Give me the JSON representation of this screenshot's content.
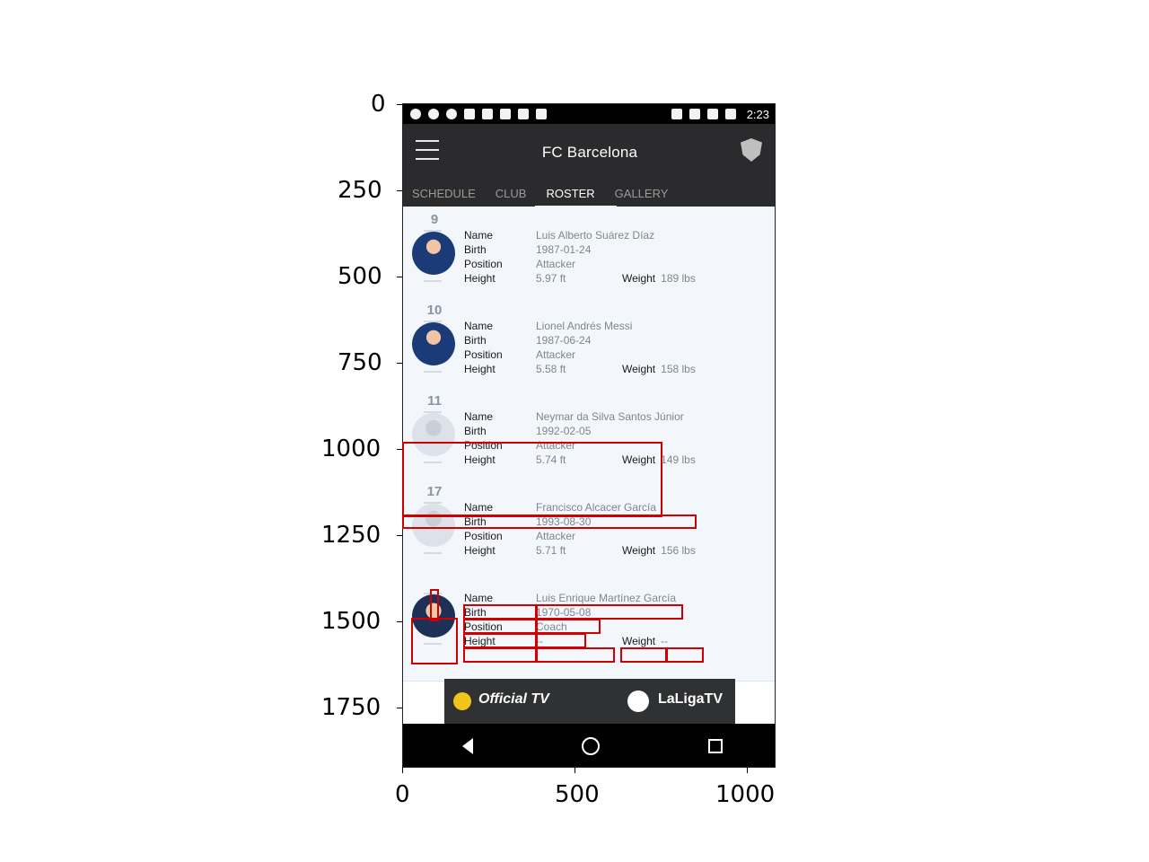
{
  "axes": {
    "y_ticks": [
      "0",
      "250",
      "500",
      "750",
      "1000",
      "1250",
      "1500",
      "1750"
    ],
    "x_ticks": [
      "0",
      "500",
      "1000"
    ]
  },
  "status_bar": {
    "time": "2:23"
  },
  "app": {
    "title": "FC Barcelona",
    "tabs": [
      "SCHEDULE",
      "CLUB",
      "ROSTER",
      "GALLERY"
    ],
    "active_tab": "ROSTER"
  },
  "labels": {
    "name": "Name",
    "birth": "Birth",
    "position": "Position",
    "height": "Height",
    "weight": "Weight"
  },
  "roster": [
    {
      "number": "9",
      "name": "Luis Alberto Suárez Díaz",
      "birth": "1987-01-24",
      "position": "Attacker",
      "height": "5.97 ft",
      "weight": "189 lbs",
      "avatar": "player-photo"
    },
    {
      "number": "10",
      "name": "Lionel Andrés Messi",
      "birth": "1987-06-24",
      "position": "Attacker",
      "height": "5.58 ft",
      "weight": "158 lbs",
      "avatar": "player-photo"
    },
    {
      "number": "11",
      "name": "Neymar da Silva Santos Júnior",
      "birth": "1992-02-05",
      "position": "Attacker",
      "height": "5.74 ft",
      "weight": "149 lbs",
      "avatar": "placeholder-silhouette"
    },
    {
      "number": "17",
      "name": "Francisco Alcacer García",
      "birth": "1993-08-30",
      "position": "Attacker",
      "height": "5.71 ft",
      "weight": "156 lbs",
      "avatar": "placeholder-silhouette"
    },
    {
      "number": "",
      "name": "Luis Enrique Martínez García",
      "birth": "1970-05-08",
      "position": "Coach",
      "height": "--",
      "weight": "--",
      "avatar": "coach-photo"
    }
  ],
  "banner": {
    "left_text": "Official TV",
    "right_text": "LaLigaTV"
  },
  "icons": {
    "menu": "hamburger-icon",
    "shield": "shield-icon",
    "back": "back-icon",
    "home": "home-icon",
    "recent": "recent-apps-icon"
  },
  "colors": {
    "app_bar": "#2b2b2d",
    "status_bar": "#000000",
    "list_bg": "#f3f6fa",
    "annotation": "#d00000"
  }
}
